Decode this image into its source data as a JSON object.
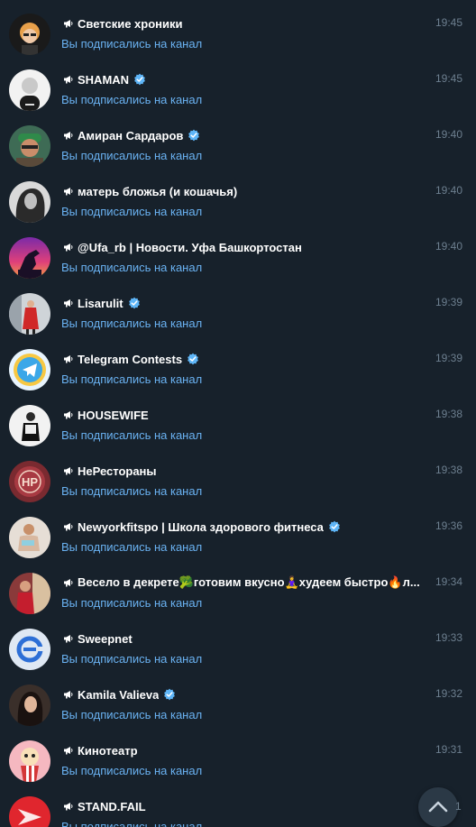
{
  "chats": [
    {
      "title": "Светские хроники",
      "time": "19:45",
      "preview": "Вы подписались на канал",
      "verified": false,
      "avatar": "woman-glasses-avatar"
    },
    {
      "title": "SHAMAN",
      "time": "19:45",
      "preview": "Вы подписались на канал",
      "verified": true,
      "avatar": "man-bw-avatar"
    },
    {
      "title": "Амиран Сардаров",
      "time": "19:40",
      "preview": "Вы подписались на канал",
      "verified": true,
      "avatar": "man-green-cap-avatar"
    },
    {
      "title": "матерь бложья (и кошачья)",
      "time": "19:40",
      "preview": "Вы подписались на канал",
      "verified": false,
      "avatar": "woman-bw-avatar"
    },
    {
      "title": "@Ufa_rb | Новости. Уфа Башкортостан",
      "time": "19:40",
      "preview": "Вы подписались на канал",
      "verified": false,
      "avatar": "monument-sunset-avatar"
    },
    {
      "title": "Lisarulit",
      "time": "19:39",
      "preview": "Вы подписались на канал",
      "verified": true,
      "avatar": "woman-red-avatar"
    },
    {
      "title": "Telegram Contests",
      "time": "19:39",
      "preview": "Вы подписались на канал",
      "verified": true,
      "avatar": "telegram-medal-avatar"
    },
    {
      "title": "HOUSEWIFE",
      "time": "19:38",
      "preview": "Вы подписались на канал",
      "verified": false,
      "avatar": "woman-white-avatar"
    },
    {
      "title": "НеРестораны",
      "time": "19:38",
      "preview": "Вы подписались на канал",
      "verified": false,
      "avatar": "hp-logo-avatar"
    },
    {
      "title": "Newyorkfitspo | Школа здорового фитнеса",
      "time": "19:36",
      "preview": "Вы подписались на канал",
      "verified": true,
      "avatar": "fitness-woman-avatar"
    },
    {
      "title": "Весело в декрете🥦готовим вкусно🧘‍♀️худеем быстро🔥л...",
      "time": "19:34",
      "preview": "Вы подписались на канал",
      "verified": false,
      "avatar": "woman-red-dress-avatar"
    },
    {
      "title": "Sweepnet",
      "time": "19:33",
      "preview": "Вы подписались на канал",
      "verified": false,
      "avatar": "sweepnet-logo-avatar"
    },
    {
      "title": "Kamila Valieva",
      "time": "19:32",
      "preview": "Вы подписались на канал",
      "verified": true,
      "avatar": "woman-dark-hair-avatar"
    },
    {
      "title": "Кинотеатр",
      "time": "19:31",
      "preview": "Вы подписались на канал",
      "verified": false,
      "avatar": "cartoon-popcorn-avatar"
    },
    {
      "title": "STAND.FAIL",
      "time": "",
      "preview": "Вы подписались на канал",
      "verified": false,
      "avatar": "standfail-logo-avatar"
    }
  ],
  "scroll_badge": "1",
  "colors": {
    "background": "#17212b",
    "title": "#ffffff",
    "preview": "#6ab2f2",
    "time": "#6d7f8f",
    "verified": "#5eb5f7"
  }
}
